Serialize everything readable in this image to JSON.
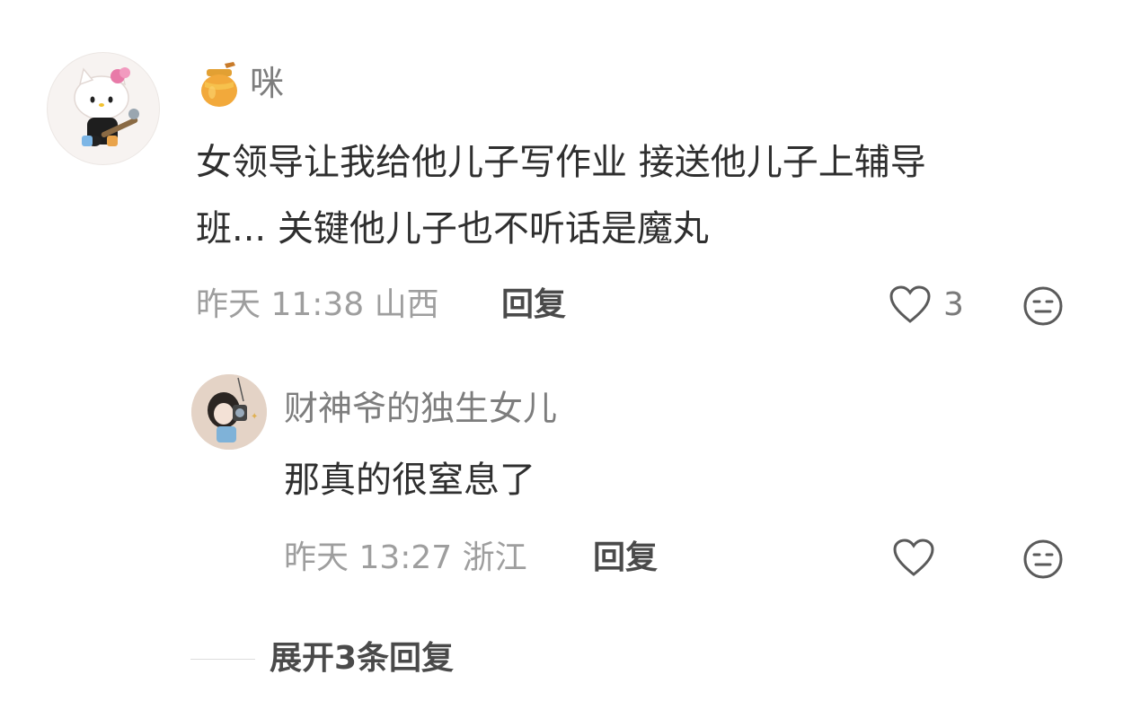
{
  "comment": {
    "username": "咪",
    "badge_icon": "honey-jar-icon",
    "text_line1": "女领导让我给他儿子写作业 接送他儿子上辅导",
    "text_line2": "班... 关键他儿子也不听话是魔丸",
    "meta": "昨天 11:38 山西",
    "reply_label": "回复",
    "like_count": "3",
    "like_icon": "heart-outline-icon",
    "dislike_icon": "meh-face-icon"
  },
  "reply": {
    "username": "财神爷的独生女儿",
    "text": "那真的很窒息了",
    "meta": "昨天 13:27 浙江",
    "reply_label": "回复",
    "like_icon": "heart-outline-icon",
    "dislike_icon": "meh-face-icon"
  },
  "expand": {
    "label": "展开3条回复"
  },
  "colors": {
    "username": "#7d7d7d",
    "text": "#2f2f2f",
    "meta": "#9e9e9e",
    "action": "#4a4a4a"
  }
}
